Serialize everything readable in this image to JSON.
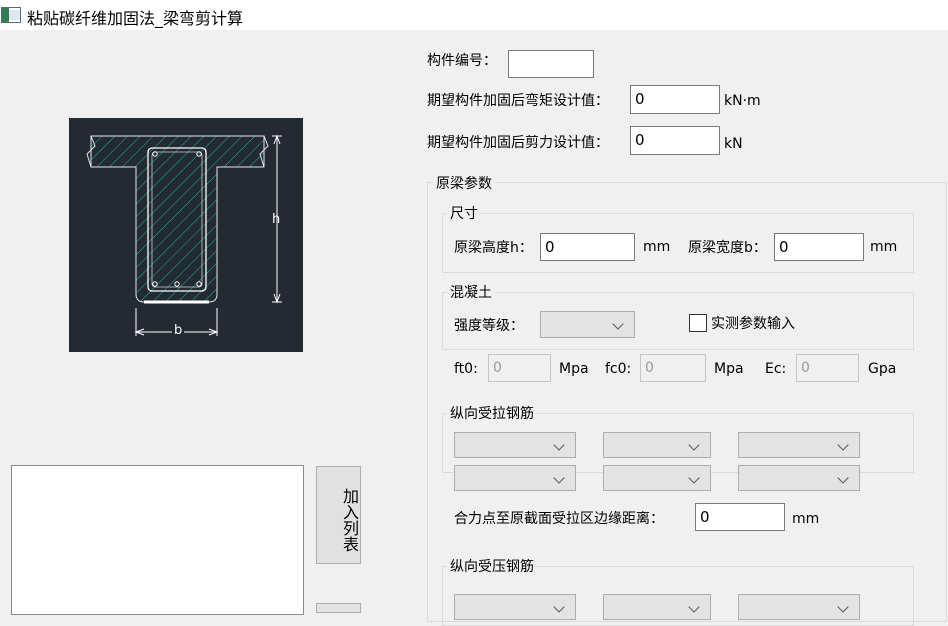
{
  "window": {
    "title": "粘贴碳纤维加固法_梁弯剪计算"
  },
  "member": {
    "id_label": "构件编号：",
    "id_value": ""
  },
  "moment": {
    "label": "期望构件加固后弯矩设计值：",
    "value": "0",
    "unit": "kN·m"
  },
  "shear": {
    "label": "期望构件加固后剪力设计值：",
    "value": "0",
    "unit": "kN"
  },
  "beam": {
    "group_title": "原梁参数",
    "size": {
      "title": "尺寸",
      "height_label": "原梁高度h：",
      "height_value": "0",
      "height_unit": "mm",
      "width_label": "原梁宽度b：",
      "width_value": "0",
      "width_unit": "mm"
    },
    "concrete": {
      "title": "混凝土",
      "grade_label": "强度等级：",
      "measured_label": "实测参数输入",
      "ft0_label": "ft0:",
      "ft0_placeholder": "0",
      "ft0_unit": "Mpa",
      "fc0_label": "fc0:",
      "fc0_placeholder": "0",
      "fc0_unit": "Mpa",
      "ec_label": "Ec:",
      "ec_placeholder": "0",
      "ec_unit": "Gpa"
    },
    "tension_rebar": {
      "title": "纵向受拉钢筋",
      "distance_label": "合力点至原截面受拉区边缘距离：",
      "distance_value": "0",
      "distance_unit": "mm"
    },
    "compression_rebar": {
      "title": "纵向受压钢筋"
    }
  },
  "diagram": {
    "h_label": "h",
    "b_label": "b"
  },
  "list": {
    "add_button": "加入列表"
  },
  "colors": {
    "concrete_fill": "#14b8a6",
    "diagram_bg": "#232a31",
    "line": "#ffffff"
  }
}
